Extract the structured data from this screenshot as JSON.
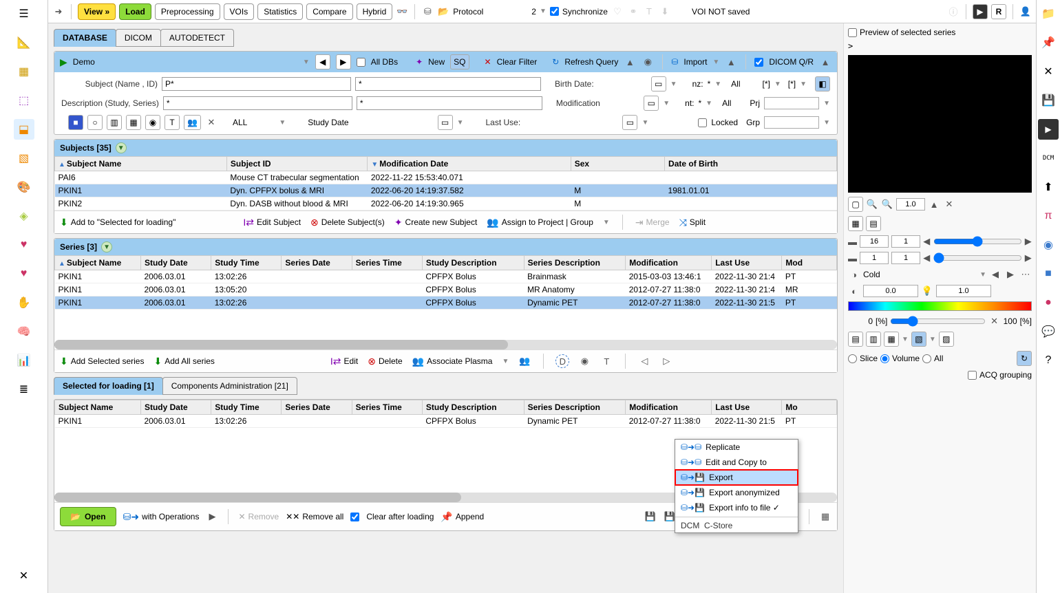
{
  "topbar": {
    "view": "View »",
    "load": "Load",
    "preproc": "Preprocessing",
    "vois": "VOIs",
    "stats": "Statistics",
    "compare": "Compare",
    "hybrid": "Hybrid",
    "protocol": "Protocol",
    "protocol_num": "2",
    "sync": "Synchronize",
    "voi_status": "VOI NOT saved",
    "r_label": "R"
  },
  "tabs": {
    "database": "DATABASE",
    "dicom": "DICOM",
    "autodetect": "AUTODETECT"
  },
  "query": {
    "source": "Demo",
    "all_dbs": "All DBs",
    "new": "New",
    "sq": "SQ",
    "clear": "Clear Filter",
    "refresh": "Refresh Query",
    "import": "Import",
    "dicom_qr": "DICOM Q/R"
  },
  "filters": {
    "subject_lbl": "Subject (Name , ID)",
    "desc_lbl": "Description (Study, Series)",
    "name_val": "P*",
    "id_val": "*",
    "study_desc_val": "*",
    "series_desc_val": "*",
    "birth_lbl": "Birth Date:",
    "mod_lbl": "Modification",
    "lastuse_lbl": "Last Use:",
    "studydate_lbl": "Study Date",
    "all_modality": "ALL",
    "nz_lbl": "nz:",
    "nt_lbl": "nt:",
    "star1": "*",
    "star2": "*",
    "all1": "All",
    "all2": "All",
    "proj_lbl": "Prj",
    "grp_lbl": "Grp",
    "locked": "Locked",
    "bracket1": "[*]",
    "bracket2": "[*]"
  },
  "subjects": {
    "header": "Subjects [35]",
    "cols": {
      "name": "Subject Name",
      "id": "Subject ID",
      "mod": "Modification Date",
      "sex": "Sex",
      "dob": "Date of Birth"
    },
    "rows": [
      {
        "name": "PAI6",
        "id": "Mouse CT trabecular segmentation",
        "mod": "2022-11-22 15:53:40.071",
        "sex": "",
        "dob": ""
      },
      {
        "name": "PKIN1",
        "id": "Dyn. CPFPX bolus & MRI",
        "mod": "2022-06-20 14:19:37.582",
        "sex": "M",
        "dob": "1981.01.01"
      },
      {
        "name": "PKIN2",
        "id": "Dyn. DASB without blood & MRI",
        "mod": "2022-06-20 14:19:30.965",
        "sex": "M",
        "dob": ""
      }
    ],
    "actions": {
      "add_selected": "Add to \"Selected for loading\"",
      "edit": "Edit Subject",
      "delete": "Delete Subject(s)",
      "create": "Create new Subject",
      "assign": "Assign to Project | Group",
      "merge": "Merge",
      "split": "Split"
    }
  },
  "series": {
    "header": "Series [3]",
    "cols": {
      "name": "Subject Name",
      "sdate": "Study Date",
      "stime": "Study Time",
      "serdate": "Series Date",
      "sertime": "Series Time",
      "sdesc": "Study Description",
      "serdesc": "Series Description",
      "mod": "Modification",
      "lastuse": "Last Use",
      "modality": "Mod"
    },
    "rows": [
      {
        "name": "PKIN1",
        "sdate": "2006.03.01",
        "stime": "13:02:26",
        "serdate": "",
        "sertime": "",
        "sdesc": "CPFPX Bolus",
        "serdesc": "Brainmask",
        "mod": "2015-03-03 13:46:1",
        "lastuse": "2022-11-30 21:4",
        "modality": "PT"
      },
      {
        "name": "PKIN1",
        "sdate": "2006.03.01",
        "stime": "13:05:20",
        "serdate": "",
        "sertime": "",
        "sdesc": "CPFPX Bolus",
        "serdesc": "MR Anatomy",
        "mod": "2012-07-27 11:38:0",
        "lastuse": "2022-11-30 21:4",
        "modality": "MR"
      },
      {
        "name": "PKIN1",
        "sdate": "2006.03.01",
        "stime": "13:02:26",
        "serdate": "",
        "sertime": "",
        "sdesc": "CPFPX Bolus",
        "serdesc": "Dynamic PET",
        "mod": "2012-07-27 11:38:0",
        "lastuse": "2022-11-30 21:5",
        "modality": "PT"
      }
    ],
    "actions": {
      "add_sel": "Add Selected series",
      "add_all": "Add All series",
      "edit": "Edit",
      "delete": "Delete",
      "assoc": "Associate Plasma"
    }
  },
  "loading_tabs": {
    "sel": "Selected for loading  [1]",
    "comp": "Components Administration [21]"
  },
  "loading": {
    "cols": {
      "name": "Subject Name",
      "sdate": "Study Date",
      "stime": "Study Time",
      "serdate": "Series Date",
      "sertime": "Series Time",
      "sdesc": "Study Description",
      "serdesc": "Series Description",
      "mod": "Modification",
      "lastuse": "Last Use",
      "modality": "Mo"
    },
    "row": {
      "name": "PKIN1",
      "sdate": "2006.03.01",
      "stime": "13:02:26",
      "serdate": "",
      "sertime": "",
      "sdesc": "CPFPX Bolus",
      "serdesc": "Dynamic PET",
      "mod": "2012-07-27 11:38:0",
      "lastuse": "2022-11-30 21:5",
      "modality": "PT"
    }
  },
  "footer": {
    "open": "Open",
    "with_ops": "with Operations",
    "remove": "Remove",
    "remove_all": "Remove all",
    "clear_after": "Clear after loading",
    "append": "Append",
    "export": "Export"
  },
  "popup": {
    "replicate": "Replicate",
    "edit_copy": "Edit and Copy to",
    "export": "Export",
    "export_anon": "Export anonymized",
    "export_info": "Export info to file  ✓",
    "dcm_label": "DCM",
    "cstore": "C-Store"
  },
  "preview": {
    "checkbox_label": "Preview of selected series",
    "marker": ">",
    "zoom": "1.0",
    "frame_a": "16",
    "frame_b": "1",
    "slice_a": "1",
    "slice_b": "1",
    "colormap": "Cold",
    "min": "0.0",
    "max": "1.0",
    "pct0_left": "0",
    "pct0_unit": "[%]",
    "pct100": "100",
    "pct100_unit": "[%]",
    "slice_mode": "Slice",
    "volume_mode": "Volume",
    "all_mode": "All",
    "acq_group": "ACQ grouping"
  }
}
